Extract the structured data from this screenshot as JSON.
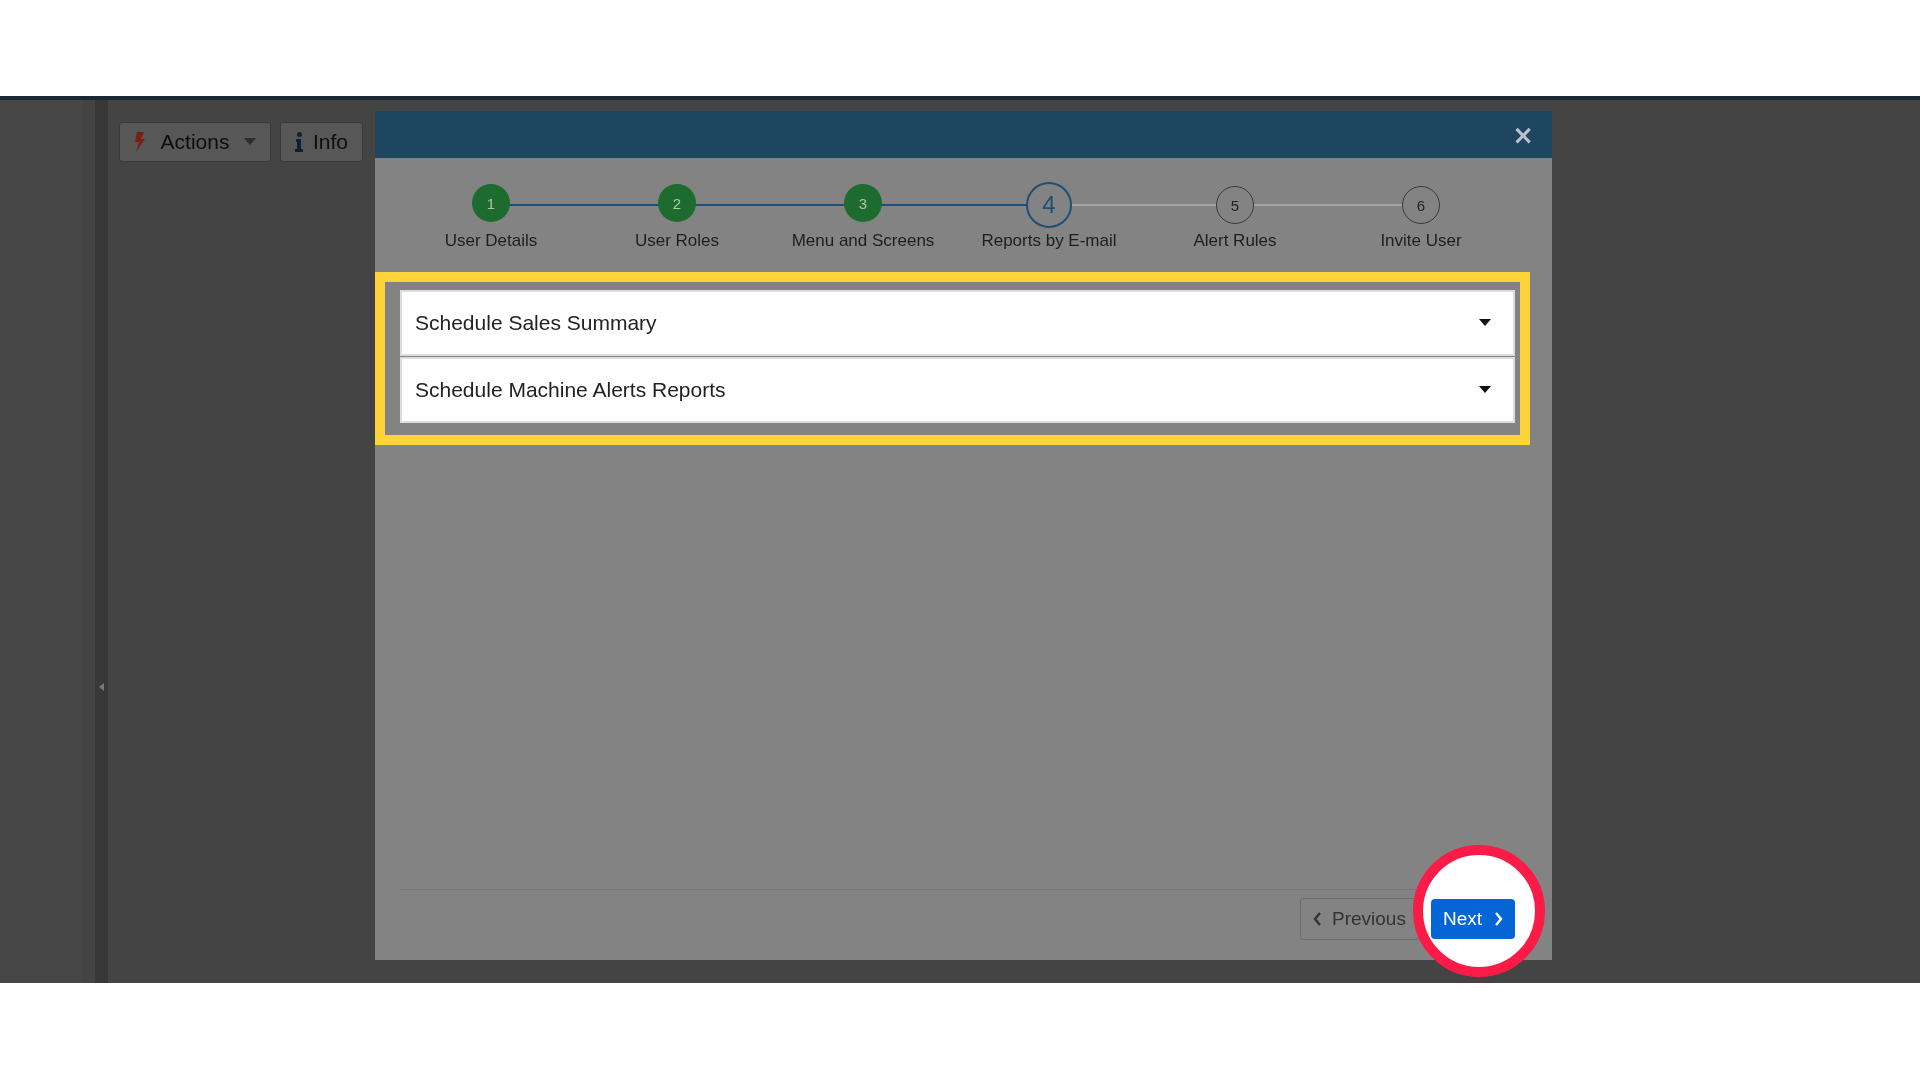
{
  "toolbar": {
    "buttons": [
      {
        "kind": "actions",
        "label": "Actions"
      },
      {
        "kind": "info",
        "label": "Info"
      }
    ]
  },
  "dialog": {
    "close": "×",
    "steps": [
      {
        "number": "1",
        "label": "User Details",
        "completed": true,
        "selected": false
      },
      {
        "number": "2",
        "label": "User Roles",
        "completed": true,
        "selected": false
      },
      {
        "number": "3",
        "label": "Menu and Screens",
        "completed": true,
        "selected": false
      },
      {
        "number": "4",
        "label": "Reports by E-mail",
        "completed": false,
        "selected": true
      },
      {
        "number": "5",
        "label": "Alert Rules",
        "completed": false,
        "selected": false
      },
      {
        "number": "6",
        "label": "Invite User",
        "completed": false,
        "selected": false
      }
    ],
    "sections": [
      {
        "title": "Schedule Sales Summary",
        "expanded": false
      },
      {
        "title": "Schedule Machine Alerts Reports",
        "expanded": false
      }
    ],
    "buttons": {
      "previous": "Previous",
      "next": "Next"
    }
  }
}
